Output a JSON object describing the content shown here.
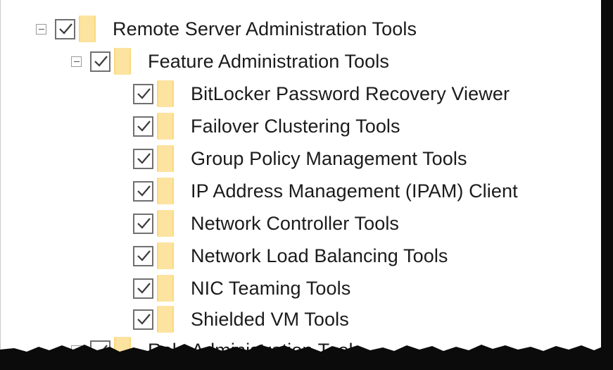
{
  "tree": {
    "root": {
      "label": "Remote Server Administration Tools",
      "checked": true,
      "expanded": true
    },
    "feature_group": {
      "label": "Feature Administration Tools",
      "checked": true,
      "expanded": true
    },
    "features": [
      {
        "label": "BitLocker Password Recovery Viewer",
        "checked": true
      },
      {
        "label": "Failover Clustering Tools",
        "checked": true
      },
      {
        "label": "Group Policy Management Tools",
        "checked": true
      },
      {
        "label": "IP Address Management (IPAM) Client",
        "checked": true
      },
      {
        "label": "Network Controller Tools",
        "checked": true
      },
      {
        "label": "Network Load Balancing Tools",
        "checked": true
      },
      {
        "label": "NIC Teaming Tools",
        "checked": true
      },
      {
        "label": "Shielded VM Tools",
        "checked": true
      }
    ],
    "role_group": {
      "label": "Role Administration Tools",
      "checked": true
    }
  },
  "colors": {
    "folder": "#fbd97a",
    "checkbox_border": "#707070",
    "torn_edge": "#0b0b0b"
  },
  "icons": {
    "expander": "collapse-box-icon",
    "checkbox": "checkbox-icon",
    "folder": "folder-icon"
  }
}
